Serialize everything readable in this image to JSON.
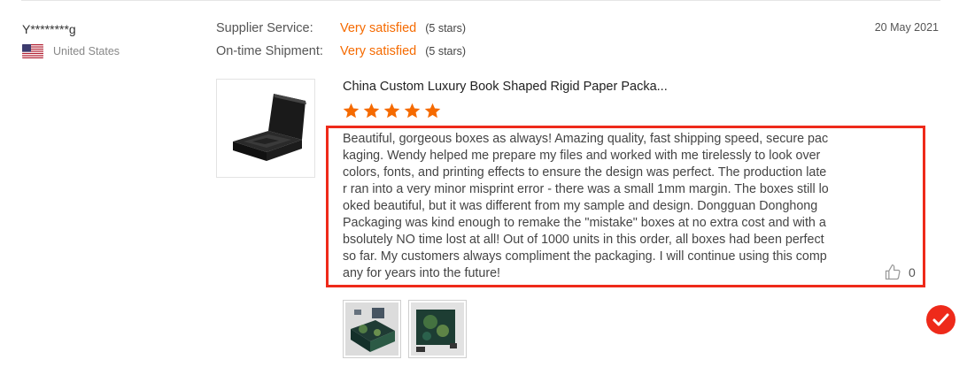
{
  "reviewer": {
    "name": "Y********g",
    "country": "United States",
    "flag_icon": "us-flag-icon"
  },
  "ratings": [
    {
      "label": "Supplier Service:",
      "value": "Very satisfied",
      "stars_text": "(5 stars)"
    },
    {
      "label": "On-time Shipment:",
      "value": "Very satisfied",
      "stars_text": "(5 stars)"
    }
  ],
  "date": "20 May 2021",
  "product": {
    "title": "China Custom Luxury Book Shaped Rigid Paper Packa...",
    "rating": 5
  },
  "review": {
    "text": "Beautiful, gorgeous boxes as always! Amazing quality, fast shipping speed, secure packaging. Wendy helped me prepare my files and worked with me tirelessly to look over colors, fonts, and printing effects to ensure the design was perfect. The production later ran into a very minor misprint error - there was a small 1mm margin. The boxes still looked beautiful, but it was different from my sample and design. Dongguan Donghong Packaging was kind enough to remake the \"mistake\" boxes at no extra cost and with absolutely NO time lost at all! Out of 1000 units in this order, all boxes had been perfect so far. My customers always compliment the packaging. I will continue using this company for years into the future!",
    "like_count": "0"
  },
  "colors": {
    "accent": "#f56a00",
    "highlight": "#ee2a1a",
    "star": "#f56a00",
    "badge": "#ee2a1a"
  }
}
